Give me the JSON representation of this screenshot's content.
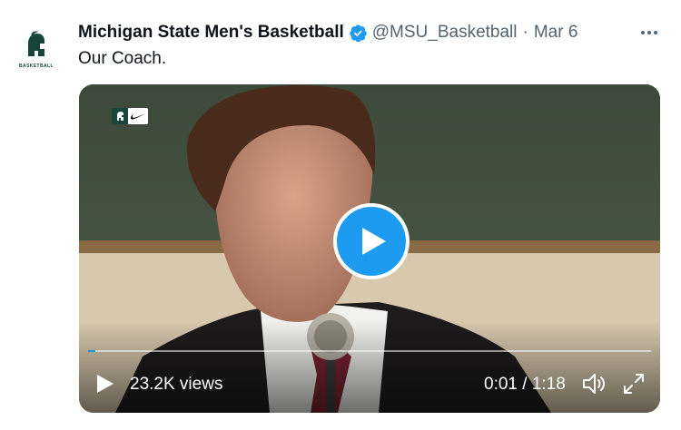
{
  "tweet": {
    "avatar_text": "BASKETBALL",
    "display_name": "Michigan State Men's Basketball",
    "handle": "@MSU_Basketball",
    "separator": "·",
    "timestamp": "Mar 6",
    "text": "Our Coach."
  },
  "video": {
    "views": "23.2K views",
    "time": "0:01 / 1:18",
    "progress_fraction": 0.013
  },
  "colors": {
    "accent": "#1d9bf0",
    "brand_green": "#18453b",
    "secondary_text": "#536471"
  },
  "icons": {
    "verified": "verified-badge-icon",
    "more": "more-options-icon",
    "play": "play-icon",
    "volume": "volume-icon",
    "fullscreen": "fullscreen-icon"
  }
}
